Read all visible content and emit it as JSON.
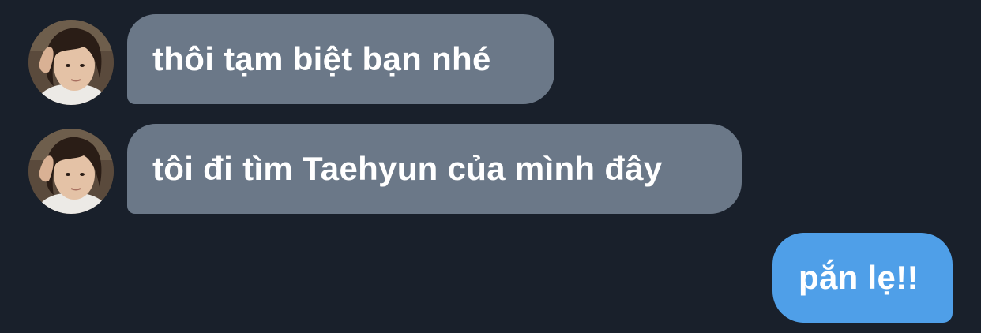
{
  "theme": {
    "background": "#19202b",
    "incoming_bubble": "#6b7888",
    "outgoing_bubble": "#4f9fe8",
    "text": "#ffffff"
  },
  "messages": [
    {
      "direction": "incoming",
      "avatar": "contact-avatar",
      "text": "thôi tạm biệt bạn nhé"
    },
    {
      "direction": "incoming",
      "avatar": "contact-avatar",
      "text": "tôi đi tìm Taehyun của mình đây"
    },
    {
      "direction": "outgoing",
      "text": "pắn lẹ!!"
    }
  ]
}
